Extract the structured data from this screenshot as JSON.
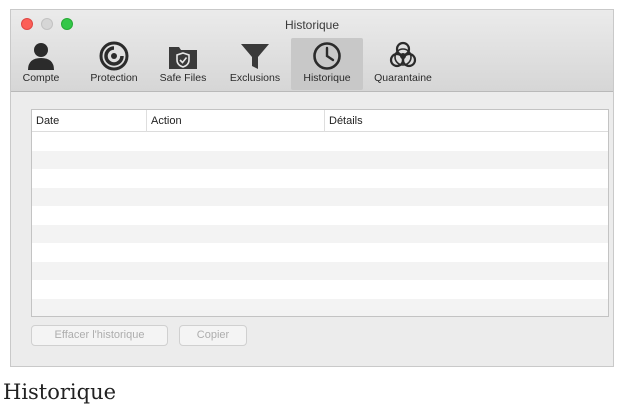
{
  "window": {
    "title": "Historique"
  },
  "toolbar": {
    "items": [
      {
        "label": "Compte",
        "icon": "user-icon"
      },
      {
        "label": "Protection",
        "icon": "protection-icon"
      },
      {
        "label": "Safe Files",
        "icon": "safe-files-icon"
      },
      {
        "label": "Exclusions",
        "icon": "filter-icon"
      },
      {
        "label": "Historique",
        "icon": "clock-icon",
        "selected": true
      },
      {
        "label": "Quarantaine",
        "icon": "biohazard-icon"
      }
    ]
  },
  "table": {
    "columns": [
      "Date",
      "Action",
      "Détails"
    ],
    "rows": []
  },
  "buttons": {
    "clear_label": "Effacer l'historique",
    "copy_label": "Copier"
  },
  "caption": "Historique",
  "colors": {
    "close": "#fc5f57",
    "minimize": "#d6d6d6",
    "zoom": "#33c748",
    "selected_tab": "#c8c8c8",
    "row_stripe": "#f3f3f3"
  }
}
